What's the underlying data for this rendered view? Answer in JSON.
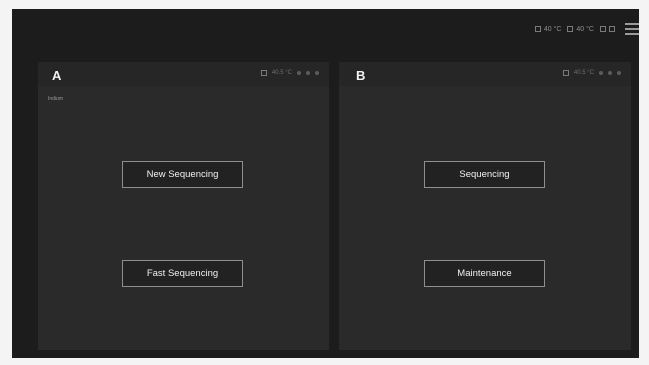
{
  "topbar": {
    "items": [
      {
        "icon": "chip-icon",
        "text": "40 °C"
      },
      {
        "icon": "chip-icon",
        "text": "40 °C"
      },
      {
        "icon": "status-icon",
        "text": ""
      }
    ]
  },
  "panels": [
    {
      "letter": "A",
      "sub": "",
      "note": "Indium",
      "status": "40.5 °C",
      "buttons": [
        "New Sequencing",
        "Fast Sequencing"
      ]
    },
    {
      "letter": "B",
      "sub": "",
      "note": "",
      "status": "40.5 °C",
      "buttons": [
        "Sequencing",
        "Maintenance"
      ]
    }
  ]
}
